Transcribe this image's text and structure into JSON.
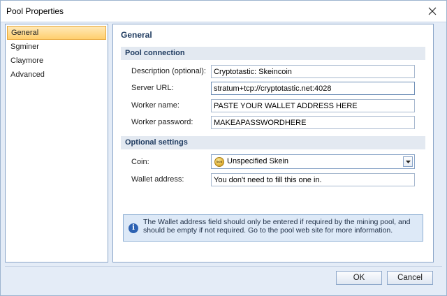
{
  "window": {
    "title": "Pool Properties"
  },
  "nav": {
    "items": [
      {
        "label": "General",
        "active": true
      },
      {
        "label": "Sgminer",
        "active": false
      },
      {
        "label": "Claymore",
        "active": false
      },
      {
        "label": "Advanced",
        "active": false
      }
    ]
  },
  "panel": {
    "title": "General",
    "pool_connection": {
      "heading": "Pool connection",
      "description_label": "Description (optional):",
      "description_value": "Cryptotastic: Skeincoin",
      "server_label": "Server URL:",
      "server_value": "stratum+tcp://cryptotastic.net:4028",
      "worker_label": "Worker name:",
      "worker_value": "PASTE YOUR WALLET ADDRESS HERE",
      "password_label": "Worker password:",
      "password_value": "MAKEAPASSWORDHERE"
    },
    "optional": {
      "heading": "Optional settings",
      "coin_label": "Coin:",
      "coin_value": "Unspecified Skein",
      "coin_icon": "coin-icon",
      "wallet_label": "Wallet address:",
      "wallet_value": "You don't need to fill this one in."
    },
    "info": {
      "icon": "info-icon",
      "text": "The Wallet address field should only be entered if required by the mining pool, and should be empty if not required. Go to the pool web site for more information."
    }
  },
  "footer": {
    "ok_label": "OK",
    "cancel_label": "Cancel"
  },
  "colors": {
    "accent": "#ffcf6e",
    "section_bg": "#e3e9f1",
    "info_bg": "#dde9f7",
    "title_text": "#1e3a5f"
  }
}
